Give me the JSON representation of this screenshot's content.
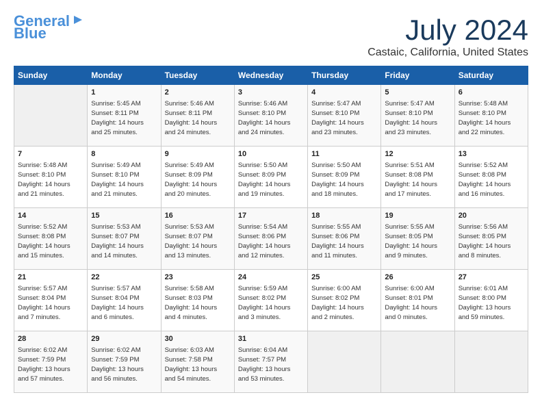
{
  "header": {
    "logo_line1": "General",
    "logo_line2": "Blue",
    "month_year": "July 2024",
    "location": "Castaic, California, United States"
  },
  "days_of_week": [
    "Sunday",
    "Monday",
    "Tuesday",
    "Wednesday",
    "Thursday",
    "Friday",
    "Saturday"
  ],
  "weeks": [
    [
      {
        "day": "",
        "info": ""
      },
      {
        "day": "1",
        "info": "Sunrise: 5:45 AM\nSunset: 8:11 PM\nDaylight: 14 hours\nand 25 minutes."
      },
      {
        "day": "2",
        "info": "Sunrise: 5:46 AM\nSunset: 8:11 PM\nDaylight: 14 hours\nand 24 minutes."
      },
      {
        "day": "3",
        "info": "Sunrise: 5:46 AM\nSunset: 8:10 PM\nDaylight: 14 hours\nand 24 minutes."
      },
      {
        "day": "4",
        "info": "Sunrise: 5:47 AM\nSunset: 8:10 PM\nDaylight: 14 hours\nand 23 minutes."
      },
      {
        "day": "5",
        "info": "Sunrise: 5:47 AM\nSunset: 8:10 PM\nDaylight: 14 hours\nand 23 minutes."
      },
      {
        "day": "6",
        "info": "Sunrise: 5:48 AM\nSunset: 8:10 PM\nDaylight: 14 hours\nand 22 minutes."
      }
    ],
    [
      {
        "day": "7",
        "info": "Sunrise: 5:48 AM\nSunset: 8:10 PM\nDaylight: 14 hours\nand 21 minutes."
      },
      {
        "day": "8",
        "info": "Sunrise: 5:49 AM\nSunset: 8:10 PM\nDaylight: 14 hours\nand 21 minutes."
      },
      {
        "day": "9",
        "info": "Sunrise: 5:49 AM\nSunset: 8:09 PM\nDaylight: 14 hours\nand 20 minutes."
      },
      {
        "day": "10",
        "info": "Sunrise: 5:50 AM\nSunset: 8:09 PM\nDaylight: 14 hours\nand 19 minutes."
      },
      {
        "day": "11",
        "info": "Sunrise: 5:50 AM\nSunset: 8:09 PM\nDaylight: 14 hours\nand 18 minutes."
      },
      {
        "day": "12",
        "info": "Sunrise: 5:51 AM\nSunset: 8:08 PM\nDaylight: 14 hours\nand 17 minutes."
      },
      {
        "day": "13",
        "info": "Sunrise: 5:52 AM\nSunset: 8:08 PM\nDaylight: 14 hours\nand 16 minutes."
      }
    ],
    [
      {
        "day": "14",
        "info": "Sunrise: 5:52 AM\nSunset: 8:08 PM\nDaylight: 14 hours\nand 15 minutes."
      },
      {
        "day": "15",
        "info": "Sunrise: 5:53 AM\nSunset: 8:07 PM\nDaylight: 14 hours\nand 14 minutes."
      },
      {
        "day": "16",
        "info": "Sunrise: 5:53 AM\nSunset: 8:07 PM\nDaylight: 14 hours\nand 13 minutes."
      },
      {
        "day": "17",
        "info": "Sunrise: 5:54 AM\nSunset: 8:06 PM\nDaylight: 14 hours\nand 12 minutes."
      },
      {
        "day": "18",
        "info": "Sunrise: 5:55 AM\nSunset: 8:06 PM\nDaylight: 14 hours\nand 11 minutes."
      },
      {
        "day": "19",
        "info": "Sunrise: 5:55 AM\nSunset: 8:05 PM\nDaylight: 14 hours\nand 9 minutes."
      },
      {
        "day": "20",
        "info": "Sunrise: 5:56 AM\nSunset: 8:05 PM\nDaylight: 14 hours\nand 8 minutes."
      }
    ],
    [
      {
        "day": "21",
        "info": "Sunrise: 5:57 AM\nSunset: 8:04 PM\nDaylight: 14 hours\nand 7 minutes."
      },
      {
        "day": "22",
        "info": "Sunrise: 5:57 AM\nSunset: 8:04 PM\nDaylight: 14 hours\nand 6 minutes."
      },
      {
        "day": "23",
        "info": "Sunrise: 5:58 AM\nSunset: 8:03 PM\nDaylight: 14 hours\nand 4 minutes."
      },
      {
        "day": "24",
        "info": "Sunrise: 5:59 AM\nSunset: 8:02 PM\nDaylight: 14 hours\nand 3 minutes."
      },
      {
        "day": "25",
        "info": "Sunrise: 6:00 AM\nSunset: 8:02 PM\nDaylight: 14 hours\nand 2 minutes."
      },
      {
        "day": "26",
        "info": "Sunrise: 6:00 AM\nSunset: 8:01 PM\nDaylight: 14 hours\nand 0 minutes."
      },
      {
        "day": "27",
        "info": "Sunrise: 6:01 AM\nSunset: 8:00 PM\nDaylight: 13 hours\nand 59 minutes."
      }
    ],
    [
      {
        "day": "28",
        "info": "Sunrise: 6:02 AM\nSunset: 7:59 PM\nDaylight: 13 hours\nand 57 minutes."
      },
      {
        "day": "29",
        "info": "Sunrise: 6:02 AM\nSunset: 7:59 PM\nDaylight: 13 hours\nand 56 minutes."
      },
      {
        "day": "30",
        "info": "Sunrise: 6:03 AM\nSunset: 7:58 PM\nDaylight: 13 hours\nand 54 minutes."
      },
      {
        "day": "31",
        "info": "Sunrise: 6:04 AM\nSunset: 7:57 PM\nDaylight: 13 hours\nand 53 minutes."
      },
      {
        "day": "",
        "info": ""
      },
      {
        "day": "",
        "info": ""
      },
      {
        "day": "",
        "info": ""
      }
    ]
  ]
}
